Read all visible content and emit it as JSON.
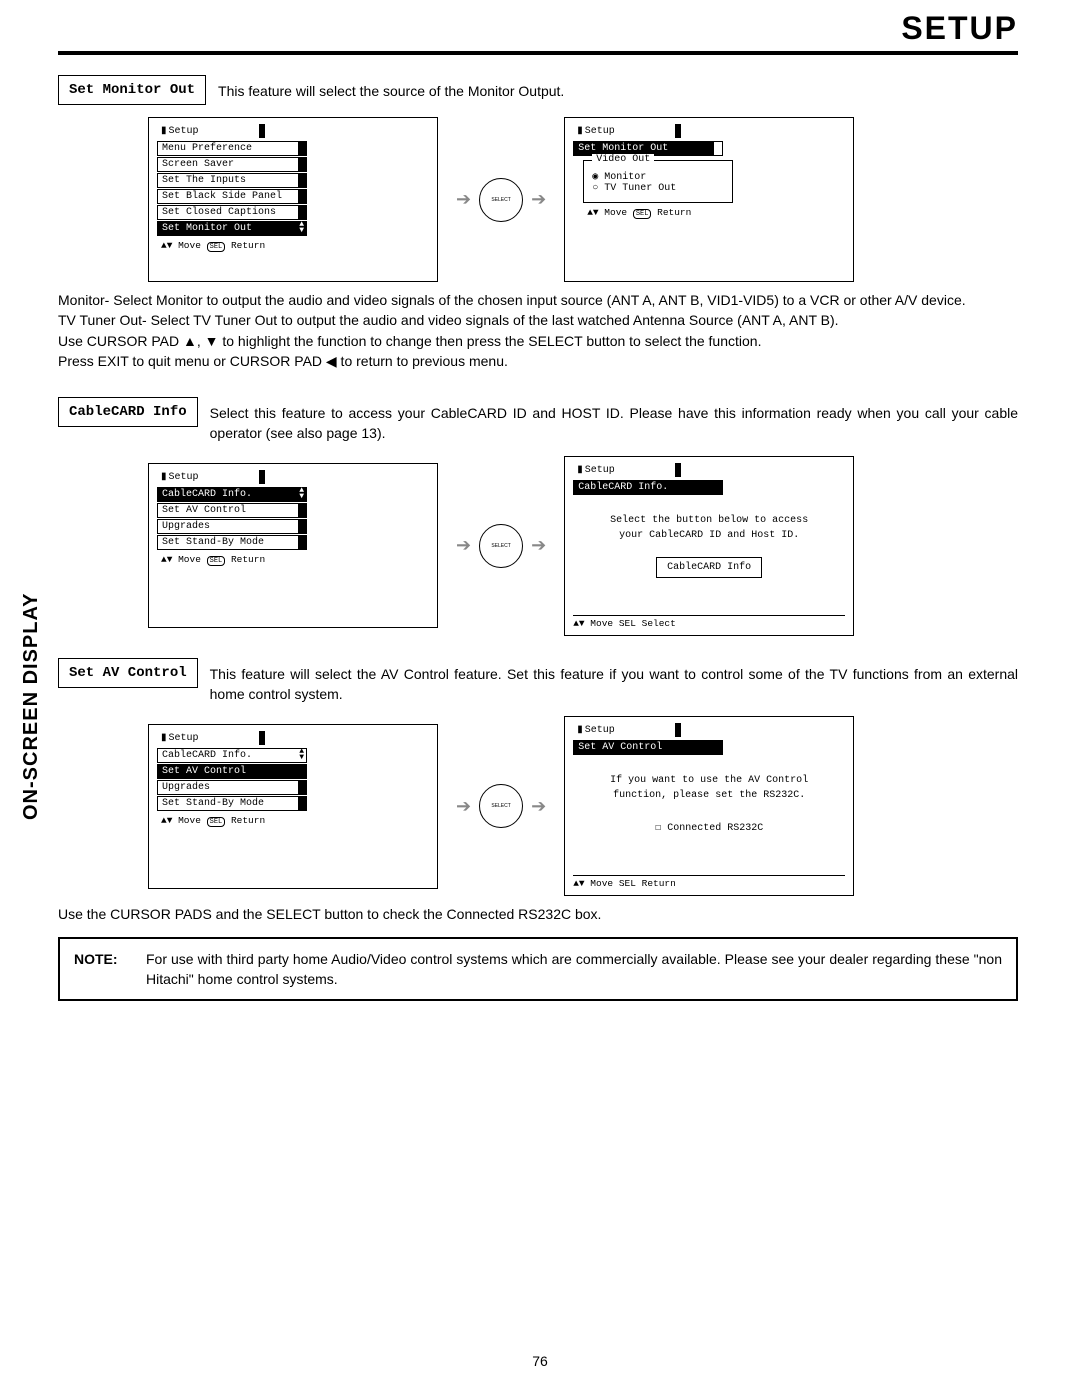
{
  "page": {
    "title": "SETUP",
    "side_label": "ON-SCREEN DISPLAY",
    "page_number": "76"
  },
  "section1": {
    "label": "Set Monitor Out",
    "desc": "This feature will select the source of the Monitor Output.",
    "osd_left": {
      "title": "Setup",
      "items": [
        "Menu Preference",
        "Screen Saver",
        "Set The Inputs",
        "Set Black Side Panel",
        "Set Closed Captions",
        "Set Monitor Out"
      ],
      "selected_index": 5,
      "hint_move": "Move",
      "hint_return": "Return"
    },
    "osd_right": {
      "title": "Setup",
      "selected": "Set Monitor Out",
      "group_label": "Video Out",
      "opt_monitor": "Monitor",
      "opt_tvtuner": "TV Tuner Out",
      "hint_move": "Move",
      "hint_return": "Return"
    },
    "body_lines": [
      "Monitor- Select Monitor to output the audio and video signals of the chosen input source (ANT A, ANT B, VID1-VID5) to a VCR or other A/V device.",
      "TV Tuner Out- Select TV Tuner Out to output the audio and video signals of the last watched Antenna Source (ANT A, ANT B).",
      "Use CURSOR PAD ▲, ▼ to highlight the function to change then press the SELECT button to select the function.",
      "Press EXIT to quit menu or CURSOR PAD ◀ to return to previous menu."
    ]
  },
  "section2": {
    "label": "CableCARD Info",
    "desc": "Select this feature to access your CableCARD ID and HOST ID.  Please have this information ready when you call your cable operator (see also page 13).",
    "osd_left": {
      "title": "Setup",
      "items": [
        "CableCARD Info.",
        "Set AV Control",
        "Upgrades",
        "Set Stand-By Mode"
      ],
      "selected_index": 0,
      "hint_move": "Move",
      "hint_return": "Return"
    },
    "osd_right": {
      "title": "Setup",
      "selected": "CableCARD Info.",
      "body_l1": "Select the button below to access",
      "body_l2": "your CableCARD ID and Host ID.",
      "button": "CableCARD Info",
      "hint_move": "Move",
      "hint_select": "Select"
    }
  },
  "section3": {
    "label": "Set AV Control",
    "desc": "This feature will select the AV Control feature.  Set this feature if you want to control some of the TV functions from an external home control system.",
    "osd_left": {
      "title": "Setup",
      "items": [
        "CableCARD Info.",
        "Set AV Control",
        "Upgrades",
        "Set Stand-By Mode"
      ],
      "selected_index": 1,
      "hint_move": "Move",
      "hint_return": "Return"
    },
    "osd_right": {
      "title": "Setup",
      "selected": "Set AV Control",
      "body_l1": "If you want to use the AV Control",
      "body_l2": "function, please set the RS232C.",
      "checkbox": "Connected RS232C",
      "hint_move": "Move",
      "hint_return": "Return"
    },
    "after_text": "Use the CURSOR PADS and the SELECT button to check the Connected RS232C box.",
    "note_label": "NOTE:",
    "note_text": "For use with third party home Audio/Video control systems which are commercially available.  Please see your dealer regarding these \"non Hitachi\" home control systems."
  },
  "glyphs": {
    "updown": "▲▼",
    "sel_badge": "SEL",
    "select_btn": "SELECT",
    "arrow_right": "➔"
  }
}
